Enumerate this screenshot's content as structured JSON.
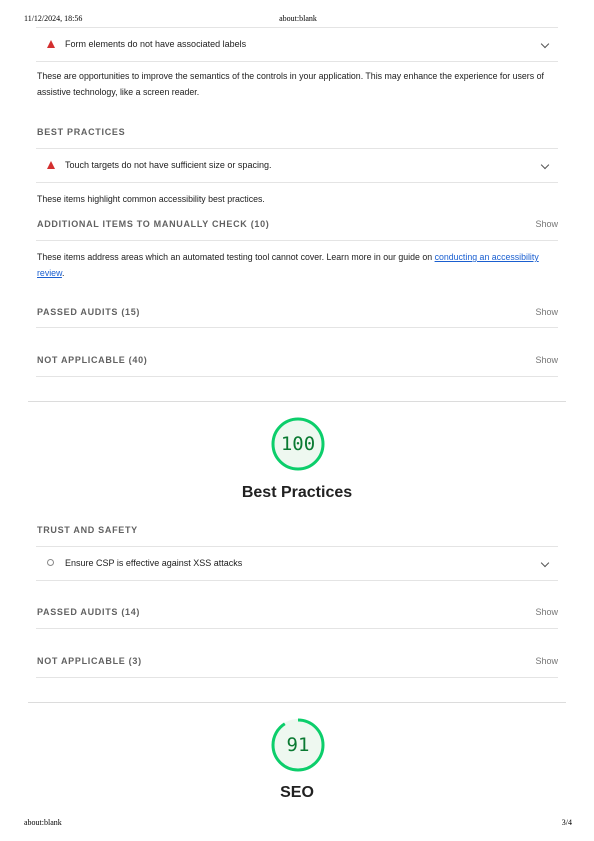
{
  "print_header": {
    "timestamp": "11/12/2024, 18:56",
    "url": "about:blank"
  },
  "print_footer": {
    "url": "about:blank",
    "page": "3/4"
  },
  "accessibility": {
    "audit_labels": "Form elements do not have associated labels",
    "names_labels_desc": "These are opportunities to improve the semantics of the controls in your application. This may enhance the experience for users of assistive technology, like a screen reader.",
    "best_practices_group": "BEST PRACTICES",
    "audit_touch": "Touch targets do not have sufficient size or spacing.",
    "best_practices_desc": "These items highlight common accessibility best practices.",
    "manual_check_title": "ADDITIONAL ITEMS TO MANUALLY CHECK",
    "manual_check_count": "(10)",
    "manual_desc_prefix": "These items address areas which an automated testing tool cannot cover. Learn more in our guide on ",
    "manual_desc_link": "conducting an accessibility review",
    "manual_desc_suffix": ".",
    "passed_title": "PASSED AUDITS",
    "passed_count": "(15)",
    "not_applicable_title": "NOT APPLICABLE",
    "not_applicable_count": "(40)"
  },
  "best_practices": {
    "score": "100",
    "score_fraction": 1.0,
    "title": "Best Practices",
    "trust_group": "TRUST AND SAFETY",
    "audit_csp": "Ensure CSP is effective against XSS attacks",
    "passed_title": "PASSED AUDITS",
    "passed_count": "(14)",
    "not_applicable_title": "NOT APPLICABLE",
    "not_applicable_count": "(3)"
  },
  "seo": {
    "score": "91",
    "score_fraction": 0.91,
    "title": "SEO"
  },
  "show_label": "Show",
  "colors": {
    "fail_red": "#d32f2f",
    "pass_green": "#0cce6b",
    "pass_text": "#0a7a32",
    "link_blue": "#1a5fd0"
  }
}
